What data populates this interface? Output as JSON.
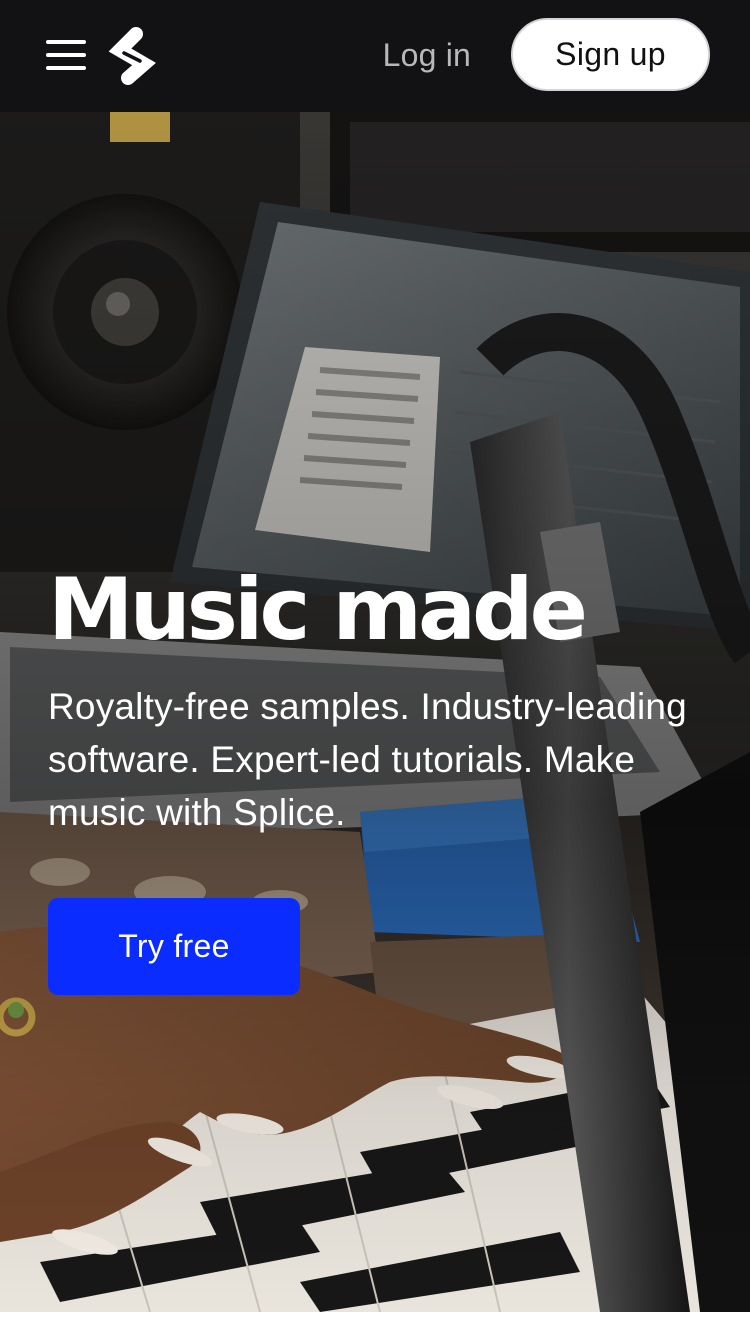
{
  "nav": {
    "menu_icon": "hamburger-menu-icon",
    "logo_icon": "splice-logo-icon",
    "login_label": "Log in",
    "signup_label": "Sign up"
  },
  "hero": {
    "title": "Music made",
    "subtitle": "Royalty-free samples. Industry-leading software. Expert-led tutorials. Make music with Splice.",
    "cta_label": "Try free",
    "photo_subject": "hands-on-keyboard-studio-photo"
  },
  "colors": {
    "nav_background": "#121214",
    "login_text": "#b8b8bc",
    "signup_background": "#ffffff",
    "cta_background": "#0b2cff",
    "hero_text": "#ffffff"
  }
}
